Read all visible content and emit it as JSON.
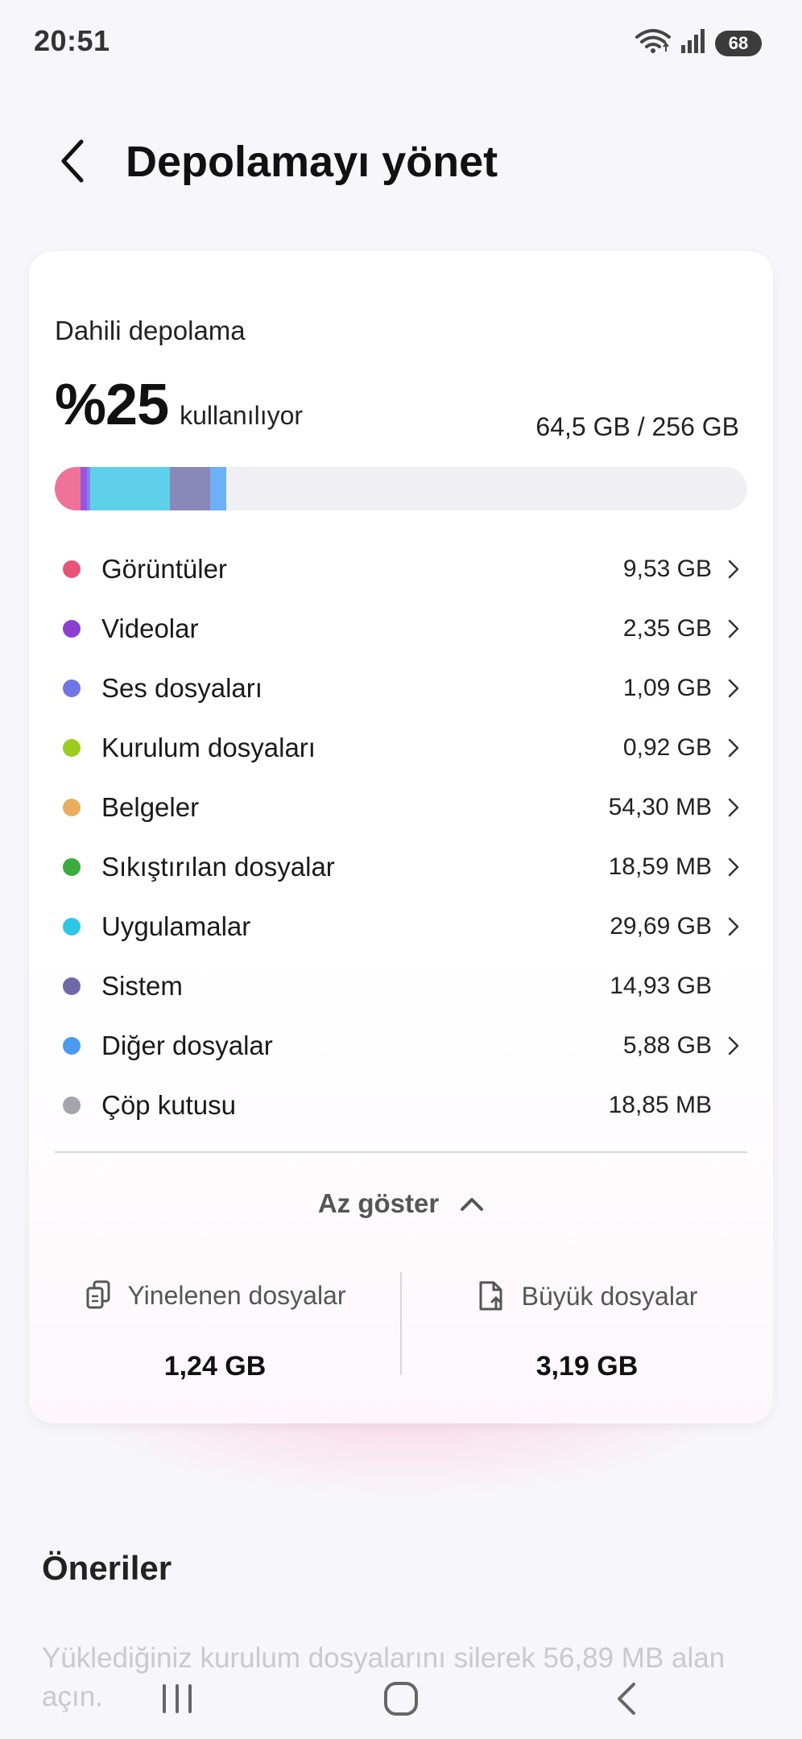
{
  "status_bar": {
    "time": "20:51",
    "battery": "68",
    "wifi_icon": "wifi-icon",
    "signal_icon": "signal-icon"
  },
  "header": {
    "title": "Depolamayı yönet",
    "back_icon": "chevron-left-icon"
  },
  "storage": {
    "label": "Dahili depolama",
    "percent": "%25",
    "percent_suffix": "kullanılıyor",
    "amount": "64,5 GB / 256 GB",
    "categories": [
      {
        "name": "Görüntüler",
        "size": "9,53 GB",
        "color": "#e8537a",
        "has_chevron": true
      },
      {
        "name": "Videolar",
        "size": "2,35 GB",
        "color": "#8a3fd1",
        "has_chevron": true
      },
      {
        "name": "Ses dosyaları",
        "size": "1,09 GB",
        "color": "#6f76e3",
        "has_chevron": true
      },
      {
        "name": "Kurulum dosyaları",
        "size": "0,92 GB",
        "color": "#9ccd1e",
        "has_chevron": true
      },
      {
        "name": "Belgeler",
        "size": "54,30 MB",
        "color": "#e8ad5e",
        "has_chevron": true
      },
      {
        "name": "Sıkıştırılan dosyalar",
        "size": "18,59 MB",
        "color": "#3caa3c",
        "has_chevron": true
      },
      {
        "name": "Uygulamalar",
        "size": "29,69 GB",
        "color": "#2fc6e6",
        "has_chevron": true
      },
      {
        "name": "Sistem",
        "size": "14,93 GB",
        "color": "#6e6aa8",
        "has_chevron": false
      },
      {
        "name": "Diğer dosyalar",
        "size": "5,88 GB",
        "color": "#4a9aee",
        "has_chevron": true
      },
      {
        "name": "Çöp kutusu",
        "size": "18,85 MB",
        "color": "#a5a4ad",
        "has_chevron": false
      }
    ],
    "bar_segments": [
      {
        "name": "images",
        "fraction": 0.0372,
        "color": "#ef7398"
      },
      {
        "name": "videos",
        "fraction": 0.0092,
        "color": "#9a55dd"
      },
      {
        "name": "audio",
        "fraction": 0.0043,
        "color": "#7f86ee"
      },
      {
        "name": "apps",
        "fraction": 0.116,
        "color": "#5fd0ea"
      },
      {
        "name": "system",
        "fraction": 0.0583,
        "color": "#8a87b9"
      },
      {
        "name": "other",
        "fraction": 0.023,
        "color": "#6cb0f5"
      }
    ],
    "show_less_label": "Az göster",
    "duplicates": {
      "label": "Yinelenen dosyalar",
      "value": "1,24 GB",
      "icon": "duplicate-files-icon"
    },
    "large_files": {
      "label": "Büyük dosyalar",
      "value": "3,19 GB",
      "icon": "large-file-icon"
    }
  },
  "suggestions": {
    "title": "Öneriler",
    "text": "Yüklediğiniz kurulum dosyalarını silerek 56,89 MB alan açın."
  },
  "nav": {
    "recents_icon": "recents-icon",
    "home_icon": "home-icon",
    "back_icon": "back-icon"
  }
}
